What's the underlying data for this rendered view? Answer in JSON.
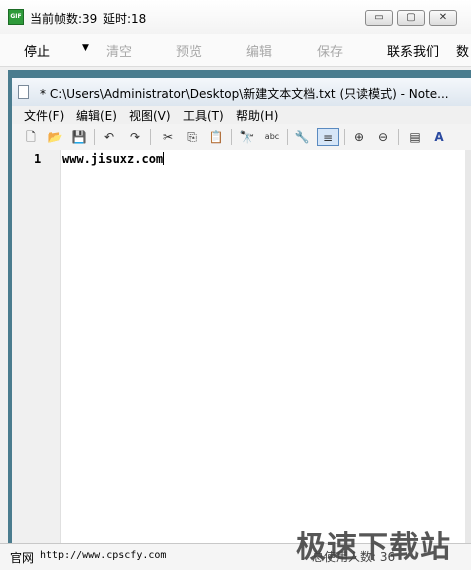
{
  "recorder": {
    "status_frames": "当前帧数:39",
    "status_delay": "延时:18",
    "app_icon_text": "GIF",
    "menu": {
      "stop": "停止",
      "clear": "清空",
      "preview": "预览",
      "edit": "编辑",
      "save": "保存",
      "contact": "联系我们",
      "overflow": "数"
    },
    "window_buttons": {
      "minimize": "▭",
      "maximize": "▢",
      "close": "✕"
    }
  },
  "notepad": {
    "title": "* C:\\Users\\Administrator\\Desktop\\新建文本文档.txt (只读模式) - Note...",
    "menu": [
      "文件(F)",
      "编辑(E)",
      "视图(V)",
      "工具(T)",
      "帮助(H)"
    ],
    "toolbar_icons": [
      "new-file-icon",
      "open-folder-icon",
      "save-disk-icon",
      "undo-icon",
      "redo-icon",
      "cut-icon",
      "copy-icon",
      "paste-icon",
      "find-icon",
      "replace-icon",
      "wrench-icon",
      "wordwrap-icon",
      "zoom-in-icon",
      "zoom-out-icon",
      "select-all-icon",
      "font-icon"
    ],
    "toolbar_glyphs": {
      "new": "🗋",
      "open": "📂",
      "save": "💾",
      "undo": "↶",
      "redo": "↷",
      "cut": "✂",
      "copy": "⎘",
      "paste": "📋",
      "find": "🔭",
      "replace": "abc",
      "wrench": "🔧",
      "wordwrap": "≡",
      "zoom_in": "⊕",
      "zoom_out": "⊖",
      "select_all": "▤",
      "font": "A"
    },
    "lines": [
      {
        "number": "1",
        "text": "www.jisuxz.com"
      }
    ]
  },
  "bottom": {
    "label": "官网",
    "url": "http://www.cpscfy.com",
    "online": "总使用人数: 36"
  },
  "watermark": "极速下载站",
  "colors": {
    "frame": "#4a7c8e",
    "active_tool": "#d6e6f8",
    "disabled_text": "#a8a8a8"
  }
}
